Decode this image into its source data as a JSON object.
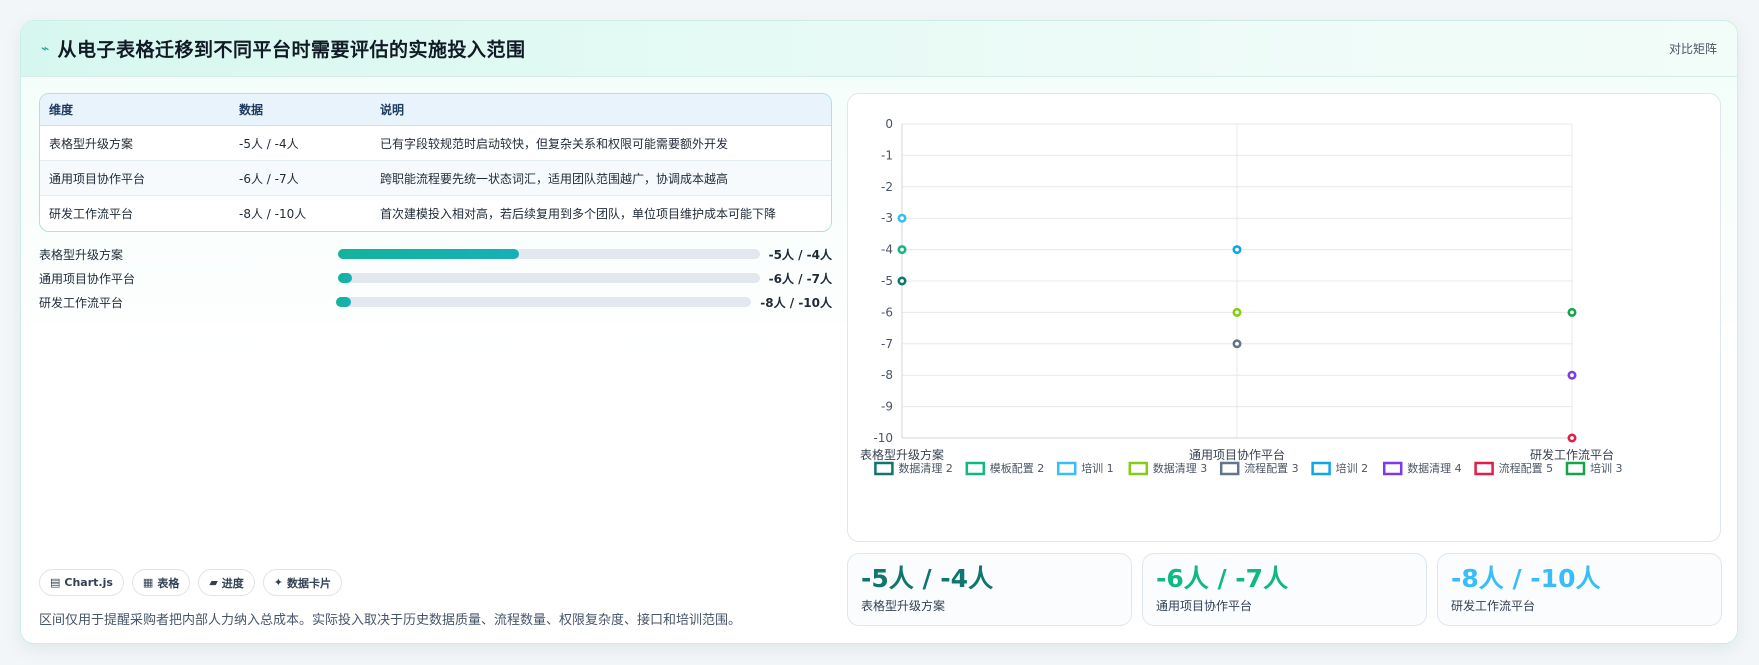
{
  "header": {
    "icon": "⌁",
    "title": "从电子表格迁移到不同平台时需要评估的实施投入范围",
    "link": "对比矩阵"
  },
  "table": {
    "headers": [
      "维度",
      "数据",
      "说明"
    ],
    "rows": [
      [
        "表格型升级方案",
        "-5人 / -4人",
        "已有字段较规范时启动较快，但复杂关系和权限可能需要额外开发"
      ],
      [
        "通用项目协作平台",
        "-6人 / -7人",
        "跨职能流程要先统一状态词汇，适用团队范围越广，协调成本越高"
      ],
      [
        "研发工作流平台",
        "-8人 / -10人",
        "首次建模投入相对高，若后续复用到多个团队，单位项目维护成本可能下降"
      ]
    ]
  },
  "progress": [
    {
      "label": "表格型升级方案",
      "value": "-5人 / -4人",
      "fill": 0.43
    },
    {
      "label": "通用项目协作平台",
      "value": "-6人 / -7人",
      "fill": 0.035
    },
    {
      "label": "研发工作流平台",
      "value": "-8人 / -10人",
      "fill": 0.035
    }
  ],
  "chips": [
    {
      "icon": "▤",
      "label": "Chart.js"
    },
    {
      "icon": "▦",
      "label": "表格"
    },
    {
      "icon": "▰",
      "label": "进度"
    },
    {
      "icon": "✦",
      "label": "数据卡片"
    }
  ],
  "note": "区间仅用于提醒采购者把内部人力纳入总成本。实际投入取决于历史数据质量、流程数量、权限复杂度、接口和培训范围。",
  "stats": [
    {
      "value": "-5人 / -4人",
      "label": "表格型升级方案",
      "color": "#0f766e"
    },
    {
      "value": "-6人 / -7人",
      "label": "通用项目协作平台",
      "color": "#10b981"
    },
    {
      "value": "-8人 / -10人",
      "label": "研发工作流平台",
      "color": "#38bdf8"
    }
  ],
  "chart_data": {
    "type": "scatter",
    "categories": [
      "表格型升级方案",
      "通用项目协作平台",
      "研发工作流平台"
    ],
    "ylim": [
      -10,
      0
    ],
    "yticks": [
      0,
      -1,
      -2,
      -3,
      -4,
      -5,
      -6,
      -7,
      -8,
      -9,
      -10
    ],
    "grid": true,
    "legend_position": "bottom",
    "series": [
      {
        "name": "数据清理 2",
        "color": "#0f766e",
        "points": [
          {
            "x": "表格型升级方案",
            "y": -5
          }
        ]
      },
      {
        "name": "模板配置 2",
        "color": "#10b981",
        "points": [
          {
            "x": "表格型升级方案",
            "y": -4
          }
        ]
      },
      {
        "name": "培训 1",
        "color": "#38bdf8",
        "points": [
          {
            "x": "表格型升级方案",
            "y": -3
          }
        ]
      },
      {
        "name": "数据清理 3",
        "color": "#84cc16",
        "points": [
          {
            "x": "通用项目协作平台",
            "y": -6
          }
        ]
      },
      {
        "name": "流程配置 3",
        "color": "#64748b",
        "points": [
          {
            "x": "通用项目协作平台",
            "y": -7
          }
        ]
      },
      {
        "name": "培训 2",
        "color": "#0ea5e9",
        "points": [
          {
            "x": "通用项目协作平台",
            "y": -4
          }
        ]
      },
      {
        "name": "数据清理 4",
        "color": "#7c3aed",
        "points": [
          {
            "x": "研发工作流平台",
            "y": -8
          }
        ]
      },
      {
        "name": "流程配置 5",
        "color": "#e11d48",
        "points": [
          {
            "x": "研发工作流平台",
            "y": -10
          }
        ]
      },
      {
        "name": "培训 3",
        "color": "#16a34a",
        "points": [
          {
            "x": "研发工作流平台",
            "y": -6
          }
        ]
      }
    ]
  }
}
